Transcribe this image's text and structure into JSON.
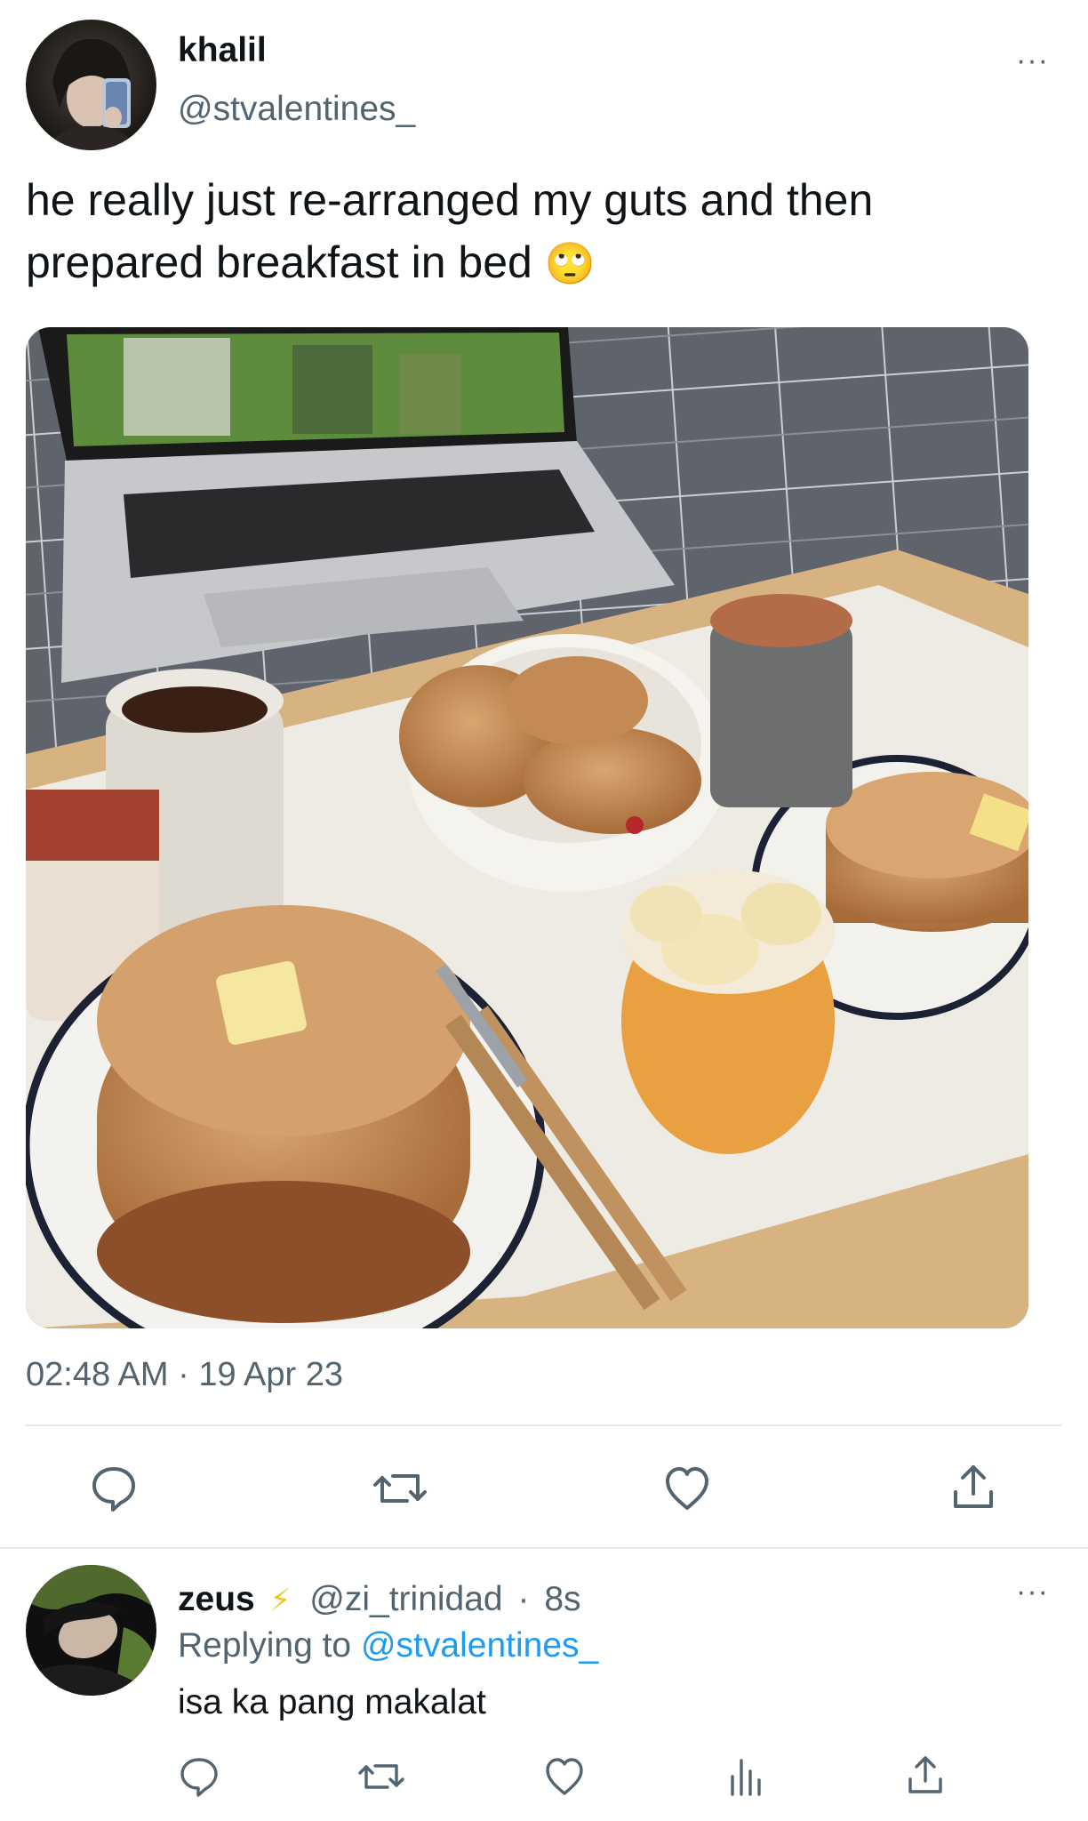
{
  "tweet": {
    "author_name": "khalil",
    "author_handle": "@stvalentines_",
    "text": "he really just re-arranged my guts and then prepared breakfast in bed",
    "emoji": "🙄",
    "timestamp": "02:48 AM · 19 Apr 23",
    "more_label": "···",
    "actions": {
      "reply_icon": "reply-icon",
      "retweet_icon": "retweet-icon",
      "like_icon": "heart-icon",
      "share_icon": "share-icon"
    }
  },
  "reply": {
    "author_name": "zeus",
    "badge": "⚡",
    "author_handle": "@zi_trinidad",
    "time_sep": "·",
    "time_ago": "8s",
    "replying_to_label": "Replying to",
    "replying_to_handle": "@stvalentines_",
    "text": "isa ka pang makalat",
    "more_label": "···",
    "actions": {
      "reply_icon": "reply-icon",
      "retweet_icon": "retweet-icon",
      "like_icon": "heart-icon",
      "analytics_icon": "analytics-icon",
      "share_icon": "share-icon"
    }
  },
  "colors": {
    "text_primary": "#0f1419",
    "text_secondary": "#536471",
    "link": "#1d9bf0",
    "divider": "#e3e6e8",
    "badge": "#f5c518"
  }
}
